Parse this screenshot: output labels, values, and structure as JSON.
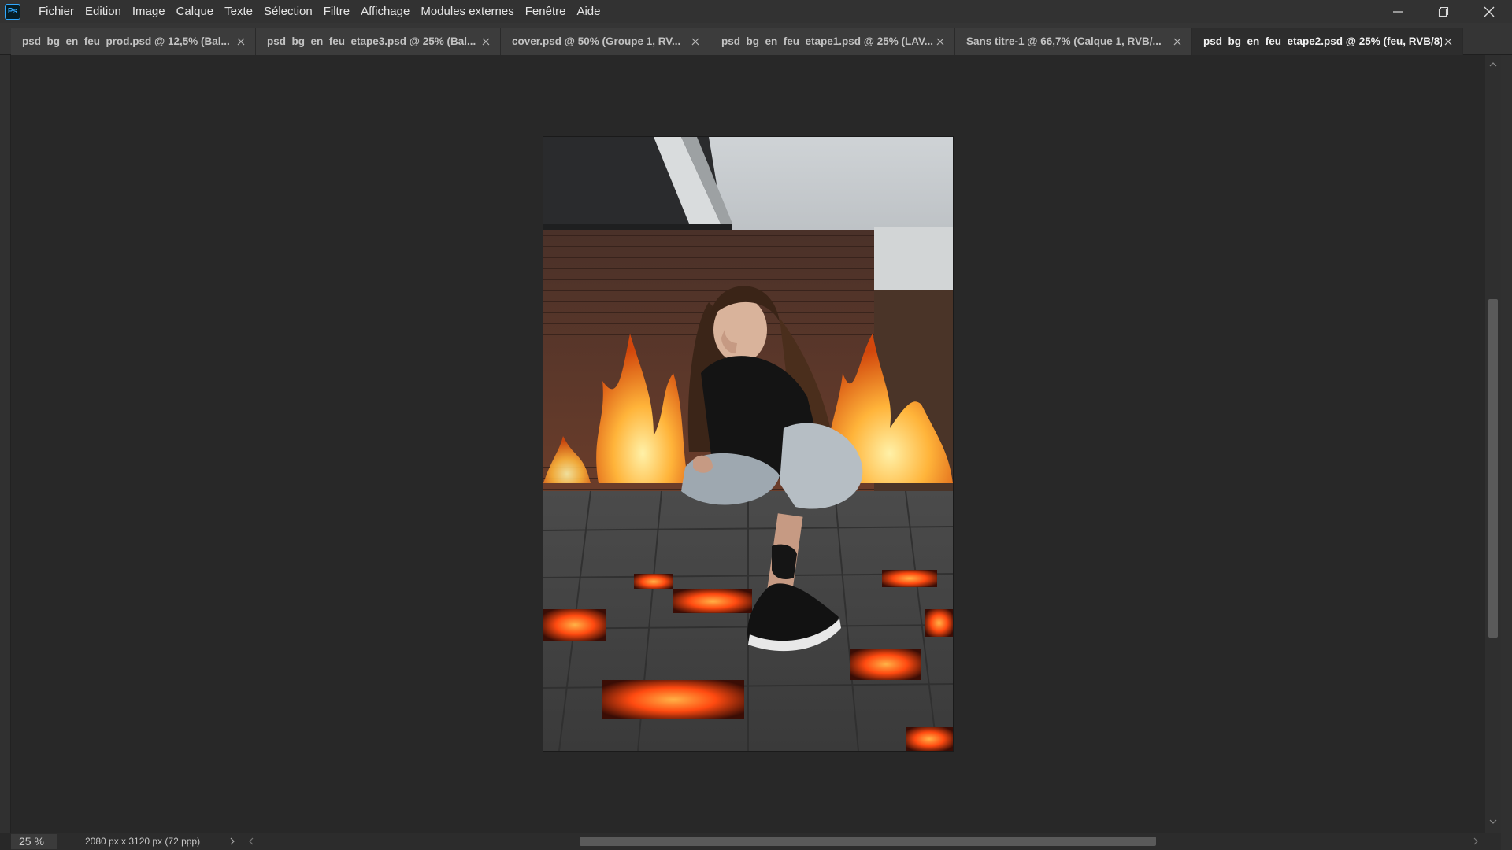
{
  "app": {
    "logo_text": "Ps",
    "accent_color": "#31a8ff"
  },
  "menu": [
    {
      "id": "fichier",
      "label": "Fichier"
    },
    {
      "id": "edition",
      "label": "Edition"
    },
    {
      "id": "image",
      "label": "Image"
    },
    {
      "id": "calque",
      "label": "Calque"
    },
    {
      "id": "texte",
      "label": "Texte"
    },
    {
      "id": "selection",
      "label": "Sélection"
    },
    {
      "id": "filtre",
      "label": "Filtre"
    },
    {
      "id": "affichage",
      "label": "Affichage"
    },
    {
      "id": "modules-externes",
      "label": "Modules externes"
    },
    {
      "id": "fenetre",
      "label": "Fenêtre"
    },
    {
      "id": "aide",
      "label": "Aide"
    }
  ],
  "window_controls": [
    "minimize-icon",
    "restore-icon",
    "close-icon"
  ],
  "tabs": [
    {
      "label": "psd_bg_en_feu_prod.psd @ 12,5% (Bal...",
      "active": false
    },
    {
      "label": "psd_bg_en_feu_etape3.psd @ 25% (Bal...",
      "active": false
    },
    {
      "label": "cover.psd @ 50% (Groupe 1, RV...",
      "active": false
    },
    {
      "label": "psd_bg_en_feu_etape1.psd @ 25% (LAV...",
      "active": false
    },
    {
      "label": "Sans titre-1 @ 66,7% (Calque 1, RVB/...",
      "active": false
    },
    {
      "label": "psd_bg_en_feu_etape2.psd @ 25% (feu, RVB/8)",
      "active": true
    }
  ],
  "status": {
    "zoom": "25 %",
    "doc_info": "2080 px x 3120 px (72 ppp)"
  },
  "colors": {
    "menubar": "#323232",
    "workspace": "#282828",
    "tab_active": "#2d2d2d",
    "tab_inactive": "#3c3c3c",
    "fire": "#ff8a1e"
  }
}
